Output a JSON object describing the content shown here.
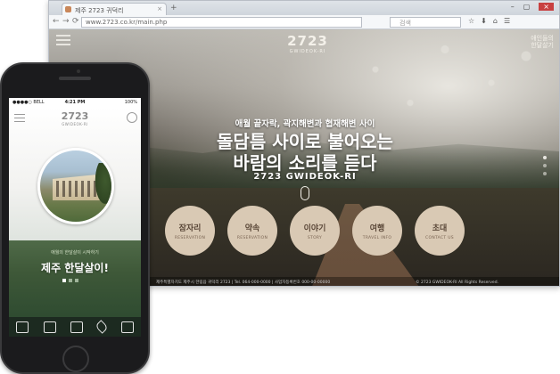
{
  "browser": {
    "tab_title": "제주 2723 귀덕리",
    "url": "www.2723.co.kr/main.php",
    "search_placeholder": "검색",
    "tab_close": "×",
    "new_tab": "+",
    "window_buttons": [
      "–",
      "▢",
      "×"
    ],
    "nav_icons": [
      "←",
      "→",
      "⟳"
    ],
    "toolbar_icons": [
      "☆",
      "⬇",
      "⌂",
      "☰"
    ]
  },
  "desktop_site": {
    "logo_number": "2723",
    "logo_sub": "GWIDEOK-RI",
    "brand_lines": [
      "애인들의",
      "한달살기"
    ],
    "subtitle": "애월 끝자락, 곽지해변과 협재해변 사이",
    "headline_line1": "돌담틈 사이로 불어오는",
    "headline_line2": "바람의 소리를 듣다",
    "place": "2723 GWIDEOK-RI",
    "menu": [
      {
        "ko": "잠자리",
        "en": "RESERVATION"
      },
      {
        "ko": "약속",
        "en": "RESERVATION"
      },
      {
        "ko": "이야기",
        "en": "STORY"
      },
      {
        "ko": "여행",
        "en": "TRAVEL INFO"
      },
      {
        "ko": "초대",
        "en": "CONTACT US"
      }
    ],
    "footer": "제주특별자치도 제주시 한림읍 귀덕리 2723  |  Tel. 064-000-0000  |  사업자등록번호 000-00-00000",
    "footer_right": "© 2723 GWIDEOK-RI All Rights Reserved."
  },
  "mobile_site": {
    "status_carrier": "●●●●○ BELL",
    "status_time": "4:21 PM",
    "status_battery": "100%",
    "logo_number": "2723",
    "logo_sub": "GWIDEOK-RI",
    "subtitle": "애월의 한달살이 시작하기",
    "headline": "제주 한달살이!",
    "tab_icons": [
      "monitor-icon",
      "search-home-icon",
      "edit-icon",
      "phone-icon",
      "bookmark-icon"
    ]
  }
}
